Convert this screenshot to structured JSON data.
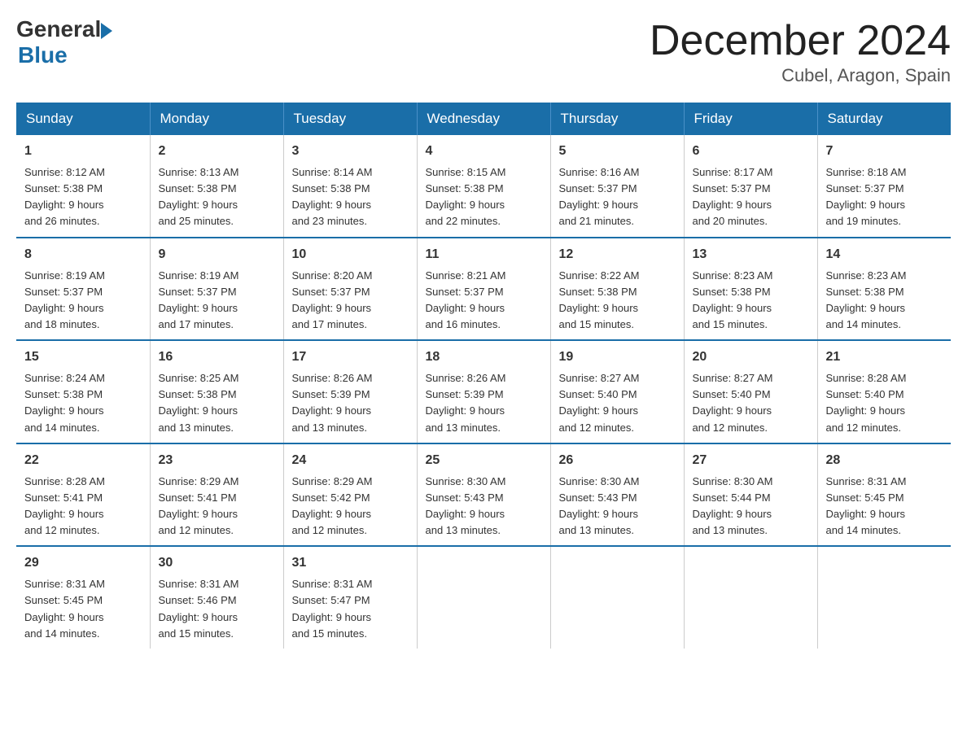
{
  "header": {
    "logo_general": "General",
    "logo_blue": "Blue",
    "month_title": "December 2024",
    "subtitle": "Cubel, Aragon, Spain"
  },
  "days_of_week": [
    "Sunday",
    "Monday",
    "Tuesday",
    "Wednesday",
    "Thursday",
    "Friday",
    "Saturday"
  ],
  "weeks": [
    [
      {
        "day": "1",
        "sunrise": "8:12 AM",
        "sunset": "5:38 PM",
        "daylight": "9 hours and 26 minutes."
      },
      {
        "day": "2",
        "sunrise": "8:13 AM",
        "sunset": "5:38 PM",
        "daylight": "9 hours and 25 minutes."
      },
      {
        "day": "3",
        "sunrise": "8:14 AM",
        "sunset": "5:38 PM",
        "daylight": "9 hours and 23 minutes."
      },
      {
        "day": "4",
        "sunrise": "8:15 AM",
        "sunset": "5:38 PM",
        "daylight": "9 hours and 22 minutes."
      },
      {
        "day": "5",
        "sunrise": "8:16 AM",
        "sunset": "5:37 PM",
        "daylight": "9 hours and 21 minutes."
      },
      {
        "day": "6",
        "sunrise": "8:17 AM",
        "sunset": "5:37 PM",
        "daylight": "9 hours and 20 minutes."
      },
      {
        "day": "7",
        "sunrise": "8:18 AM",
        "sunset": "5:37 PM",
        "daylight": "9 hours and 19 minutes."
      }
    ],
    [
      {
        "day": "8",
        "sunrise": "8:19 AM",
        "sunset": "5:37 PM",
        "daylight": "9 hours and 18 minutes."
      },
      {
        "day": "9",
        "sunrise": "8:19 AM",
        "sunset": "5:37 PM",
        "daylight": "9 hours and 17 minutes."
      },
      {
        "day": "10",
        "sunrise": "8:20 AM",
        "sunset": "5:37 PM",
        "daylight": "9 hours and 17 minutes."
      },
      {
        "day": "11",
        "sunrise": "8:21 AM",
        "sunset": "5:37 PM",
        "daylight": "9 hours and 16 minutes."
      },
      {
        "day": "12",
        "sunrise": "8:22 AM",
        "sunset": "5:38 PM",
        "daylight": "9 hours and 15 minutes."
      },
      {
        "day": "13",
        "sunrise": "8:23 AM",
        "sunset": "5:38 PM",
        "daylight": "9 hours and 15 minutes."
      },
      {
        "day": "14",
        "sunrise": "8:23 AM",
        "sunset": "5:38 PM",
        "daylight": "9 hours and 14 minutes."
      }
    ],
    [
      {
        "day": "15",
        "sunrise": "8:24 AM",
        "sunset": "5:38 PM",
        "daylight": "9 hours and 14 minutes."
      },
      {
        "day": "16",
        "sunrise": "8:25 AM",
        "sunset": "5:38 PM",
        "daylight": "9 hours and 13 minutes."
      },
      {
        "day": "17",
        "sunrise": "8:26 AM",
        "sunset": "5:39 PM",
        "daylight": "9 hours and 13 minutes."
      },
      {
        "day": "18",
        "sunrise": "8:26 AM",
        "sunset": "5:39 PM",
        "daylight": "9 hours and 13 minutes."
      },
      {
        "day": "19",
        "sunrise": "8:27 AM",
        "sunset": "5:40 PM",
        "daylight": "9 hours and 12 minutes."
      },
      {
        "day": "20",
        "sunrise": "8:27 AM",
        "sunset": "5:40 PM",
        "daylight": "9 hours and 12 minutes."
      },
      {
        "day": "21",
        "sunrise": "8:28 AM",
        "sunset": "5:40 PM",
        "daylight": "9 hours and 12 minutes."
      }
    ],
    [
      {
        "day": "22",
        "sunrise": "8:28 AM",
        "sunset": "5:41 PM",
        "daylight": "9 hours and 12 minutes."
      },
      {
        "day": "23",
        "sunrise": "8:29 AM",
        "sunset": "5:41 PM",
        "daylight": "9 hours and 12 minutes."
      },
      {
        "day": "24",
        "sunrise": "8:29 AM",
        "sunset": "5:42 PM",
        "daylight": "9 hours and 12 minutes."
      },
      {
        "day": "25",
        "sunrise": "8:30 AM",
        "sunset": "5:43 PM",
        "daylight": "9 hours and 13 minutes."
      },
      {
        "day": "26",
        "sunrise": "8:30 AM",
        "sunset": "5:43 PM",
        "daylight": "9 hours and 13 minutes."
      },
      {
        "day": "27",
        "sunrise": "8:30 AM",
        "sunset": "5:44 PM",
        "daylight": "9 hours and 13 minutes."
      },
      {
        "day": "28",
        "sunrise": "8:31 AM",
        "sunset": "5:45 PM",
        "daylight": "9 hours and 14 minutes."
      }
    ],
    [
      {
        "day": "29",
        "sunrise": "8:31 AM",
        "sunset": "5:45 PM",
        "daylight": "9 hours and 14 minutes."
      },
      {
        "day": "30",
        "sunrise": "8:31 AM",
        "sunset": "5:46 PM",
        "daylight": "9 hours and 15 minutes."
      },
      {
        "day": "31",
        "sunrise": "8:31 AM",
        "sunset": "5:47 PM",
        "daylight": "9 hours and 15 minutes."
      },
      null,
      null,
      null,
      null
    ]
  ],
  "labels": {
    "sunrise": "Sunrise:",
    "sunset": "Sunset:",
    "daylight": "Daylight:"
  }
}
